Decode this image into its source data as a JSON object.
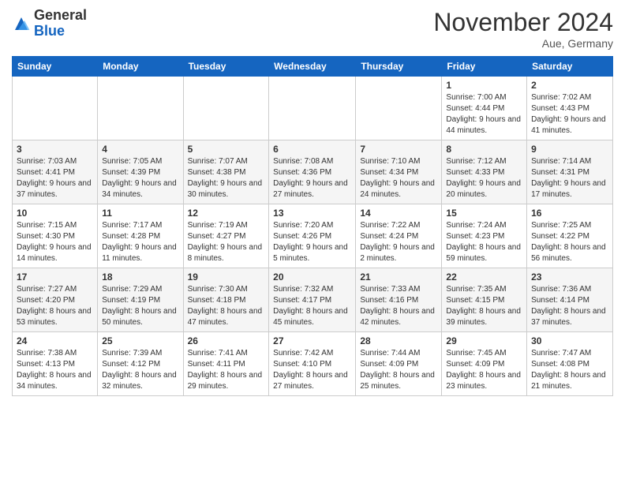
{
  "header": {
    "logo_general": "General",
    "logo_blue": "Blue",
    "month_title": "November 2024",
    "location": "Aue, Germany"
  },
  "days_of_week": [
    "Sunday",
    "Monday",
    "Tuesday",
    "Wednesday",
    "Thursday",
    "Friday",
    "Saturday"
  ],
  "weeks": [
    [
      {
        "day": "",
        "info": ""
      },
      {
        "day": "",
        "info": ""
      },
      {
        "day": "",
        "info": ""
      },
      {
        "day": "",
        "info": ""
      },
      {
        "day": "",
        "info": ""
      },
      {
        "day": "1",
        "info": "Sunrise: 7:00 AM\nSunset: 4:44 PM\nDaylight: 9 hours and 44 minutes."
      },
      {
        "day": "2",
        "info": "Sunrise: 7:02 AM\nSunset: 4:43 PM\nDaylight: 9 hours and 41 minutes."
      }
    ],
    [
      {
        "day": "3",
        "info": "Sunrise: 7:03 AM\nSunset: 4:41 PM\nDaylight: 9 hours and 37 minutes."
      },
      {
        "day": "4",
        "info": "Sunrise: 7:05 AM\nSunset: 4:39 PM\nDaylight: 9 hours and 34 minutes."
      },
      {
        "day": "5",
        "info": "Sunrise: 7:07 AM\nSunset: 4:38 PM\nDaylight: 9 hours and 30 minutes."
      },
      {
        "day": "6",
        "info": "Sunrise: 7:08 AM\nSunset: 4:36 PM\nDaylight: 9 hours and 27 minutes."
      },
      {
        "day": "7",
        "info": "Sunrise: 7:10 AM\nSunset: 4:34 PM\nDaylight: 9 hours and 24 minutes."
      },
      {
        "day": "8",
        "info": "Sunrise: 7:12 AM\nSunset: 4:33 PM\nDaylight: 9 hours and 20 minutes."
      },
      {
        "day": "9",
        "info": "Sunrise: 7:14 AM\nSunset: 4:31 PM\nDaylight: 9 hours and 17 minutes."
      }
    ],
    [
      {
        "day": "10",
        "info": "Sunrise: 7:15 AM\nSunset: 4:30 PM\nDaylight: 9 hours and 14 minutes."
      },
      {
        "day": "11",
        "info": "Sunrise: 7:17 AM\nSunset: 4:28 PM\nDaylight: 9 hours and 11 minutes."
      },
      {
        "day": "12",
        "info": "Sunrise: 7:19 AM\nSunset: 4:27 PM\nDaylight: 9 hours and 8 minutes."
      },
      {
        "day": "13",
        "info": "Sunrise: 7:20 AM\nSunset: 4:26 PM\nDaylight: 9 hours and 5 minutes."
      },
      {
        "day": "14",
        "info": "Sunrise: 7:22 AM\nSunset: 4:24 PM\nDaylight: 9 hours and 2 minutes."
      },
      {
        "day": "15",
        "info": "Sunrise: 7:24 AM\nSunset: 4:23 PM\nDaylight: 8 hours and 59 minutes."
      },
      {
        "day": "16",
        "info": "Sunrise: 7:25 AM\nSunset: 4:22 PM\nDaylight: 8 hours and 56 minutes."
      }
    ],
    [
      {
        "day": "17",
        "info": "Sunrise: 7:27 AM\nSunset: 4:20 PM\nDaylight: 8 hours and 53 minutes."
      },
      {
        "day": "18",
        "info": "Sunrise: 7:29 AM\nSunset: 4:19 PM\nDaylight: 8 hours and 50 minutes."
      },
      {
        "day": "19",
        "info": "Sunrise: 7:30 AM\nSunset: 4:18 PM\nDaylight: 8 hours and 47 minutes."
      },
      {
        "day": "20",
        "info": "Sunrise: 7:32 AM\nSunset: 4:17 PM\nDaylight: 8 hours and 45 minutes."
      },
      {
        "day": "21",
        "info": "Sunrise: 7:33 AM\nSunset: 4:16 PM\nDaylight: 8 hours and 42 minutes."
      },
      {
        "day": "22",
        "info": "Sunrise: 7:35 AM\nSunset: 4:15 PM\nDaylight: 8 hours and 39 minutes."
      },
      {
        "day": "23",
        "info": "Sunrise: 7:36 AM\nSunset: 4:14 PM\nDaylight: 8 hours and 37 minutes."
      }
    ],
    [
      {
        "day": "24",
        "info": "Sunrise: 7:38 AM\nSunset: 4:13 PM\nDaylight: 8 hours and 34 minutes."
      },
      {
        "day": "25",
        "info": "Sunrise: 7:39 AM\nSunset: 4:12 PM\nDaylight: 8 hours and 32 minutes."
      },
      {
        "day": "26",
        "info": "Sunrise: 7:41 AM\nSunset: 4:11 PM\nDaylight: 8 hours and 29 minutes."
      },
      {
        "day": "27",
        "info": "Sunrise: 7:42 AM\nSunset: 4:10 PM\nDaylight: 8 hours and 27 minutes."
      },
      {
        "day": "28",
        "info": "Sunrise: 7:44 AM\nSunset: 4:09 PM\nDaylight: 8 hours and 25 minutes."
      },
      {
        "day": "29",
        "info": "Sunrise: 7:45 AM\nSunset: 4:09 PM\nDaylight: 8 hours and 23 minutes."
      },
      {
        "day": "30",
        "info": "Sunrise: 7:47 AM\nSunset: 4:08 PM\nDaylight: 8 hours and 21 minutes."
      }
    ]
  ]
}
